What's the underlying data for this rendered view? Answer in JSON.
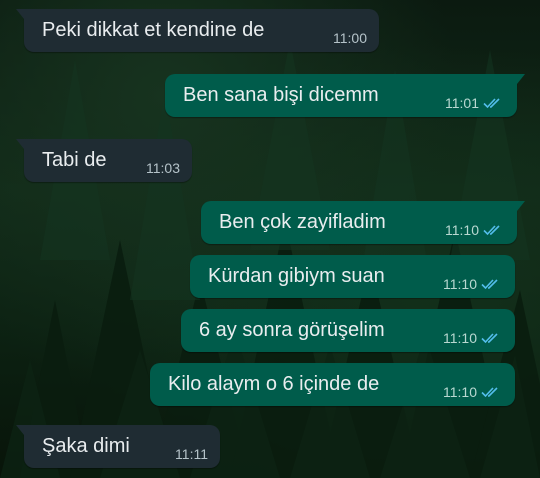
{
  "chat": {
    "messages": [
      {
        "direction": "incoming",
        "text": "Peki dikkat et kendine de",
        "time": "11:00",
        "status": null
      },
      {
        "direction": "outgoing",
        "text": "Ben sana bişi dicemm",
        "time": "11:01",
        "status": "read"
      },
      {
        "direction": "incoming",
        "text": "Tabi de",
        "time": "11:03",
        "status": null
      },
      {
        "direction": "outgoing",
        "text": "Ben çok zayifladim",
        "time": "11:10",
        "status": "read"
      },
      {
        "direction": "outgoing",
        "text": "Kürdan gibiym suan",
        "time": "11:10",
        "status": "read"
      },
      {
        "direction": "outgoing",
        "text": "6 ay sonra görüşelim",
        "time": "11:10",
        "status": "read"
      },
      {
        "direction": "outgoing",
        "text": "Kilo alaym o 6 içinde de",
        "time": "11:10",
        "status": "read"
      },
      {
        "direction": "incoming",
        "text": "Şaka dimi",
        "time": "11:11",
        "status": null
      }
    ]
  },
  "colors": {
    "incoming_bubble": "#1f2c33",
    "outgoing_bubble": "#005c4b",
    "read_ticks": "#53bdeb",
    "text": "#e9edef"
  },
  "icons": {
    "read_status": "double-check-icon"
  }
}
